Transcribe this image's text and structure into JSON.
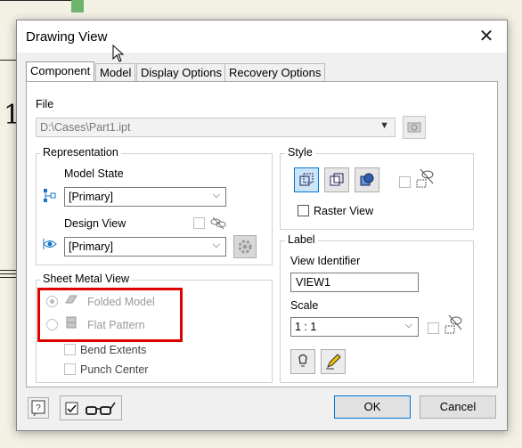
{
  "dialog": {
    "title": "Drawing View"
  },
  "tabs": [
    {
      "label": "Component",
      "active": true
    },
    {
      "label": "Model"
    },
    {
      "label": "Display Options"
    },
    {
      "label": "Recovery Options"
    }
  ],
  "file": {
    "label": "File",
    "path": "D:\\Cases\\Part1.ipt"
  },
  "representation": {
    "title": "Representation",
    "model_state_label": "Model State",
    "model_state_value": "[Primary]",
    "design_view_label": "Design View",
    "design_view_value": "[Primary]"
  },
  "sheet_metal": {
    "title": "Sheet Metal View",
    "folded_label": "Folded Model",
    "flat_label": "Flat Pattern",
    "bend_extents_label": "Bend Extents",
    "punch_center_label": "Punch Center"
  },
  "style": {
    "title": "Style",
    "raster_label": "Raster View"
  },
  "label_group": {
    "title": "Label",
    "view_identifier_label": "View Identifier",
    "view_identifier_value": "VIEW1",
    "scale_label": "Scale",
    "scale_value": "1 : 1"
  },
  "footer": {
    "ok_label": "OK",
    "cancel_label": "Cancel"
  },
  "colors": {
    "highlight": "#e00000",
    "accent": "#0078d7"
  }
}
